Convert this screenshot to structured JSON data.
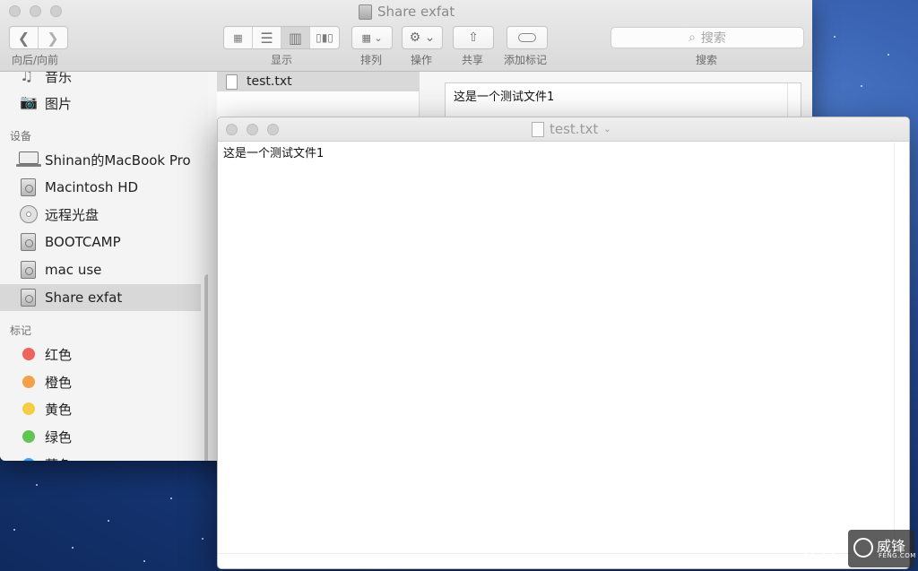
{
  "finder": {
    "title": "Share exfat",
    "toolbar": {
      "nav_label": "向后/向前",
      "view_label": "显示",
      "arrange_label": "排列",
      "action_label": "操作",
      "share_label": "共享",
      "tags_label": "添加标记",
      "search_label": "搜索",
      "search_placeholder": "搜索"
    },
    "sidebar": {
      "items_top": [
        {
          "label": "音乐",
          "icon": "music-icon"
        },
        {
          "label": "图片",
          "icon": "camera-icon"
        }
      ],
      "devices_header": "设备",
      "devices": [
        {
          "label": "Shinan的MacBook Pro",
          "icon": "laptop-icon"
        },
        {
          "label": "Macintosh HD",
          "icon": "disk-icon"
        },
        {
          "label": "远程光盘",
          "icon": "disc-icon"
        },
        {
          "label": "BOOTCAMP",
          "icon": "disk-icon"
        },
        {
          "label": "mac use",
          "icon": "disk-icon"
        },
        {
          "label": "Share exfat",
          "icon": "disk-icon"
        }
      ],
      "tags_header": "标记",
      "tags": [
        {
          "label": "红色",
          "color": "#f0625d"
        },
        {
          "label": "橙色",
          "color": "#f2a04a"
        },
        {
          "label": "黄色",
          "color": "#f4cd47"
        },
        {
          "label": "绿色",
          "color": "#61c554"
        },
        {
          "label": "蓝色",
          "color": "#3e9ef3"
        }
      ]
    },
    "files": [
      {
        "name": "test.txt"
      }
    ],
    "preview_text": "这是一个测试文件1"
  },
  "textedit": {
    "title": "test.txt",
    "content": "这是一个测试文件1"
  },
  "watermark": {
    "brand": "威锋",
    "site": "FENG.COM"
  }
}
